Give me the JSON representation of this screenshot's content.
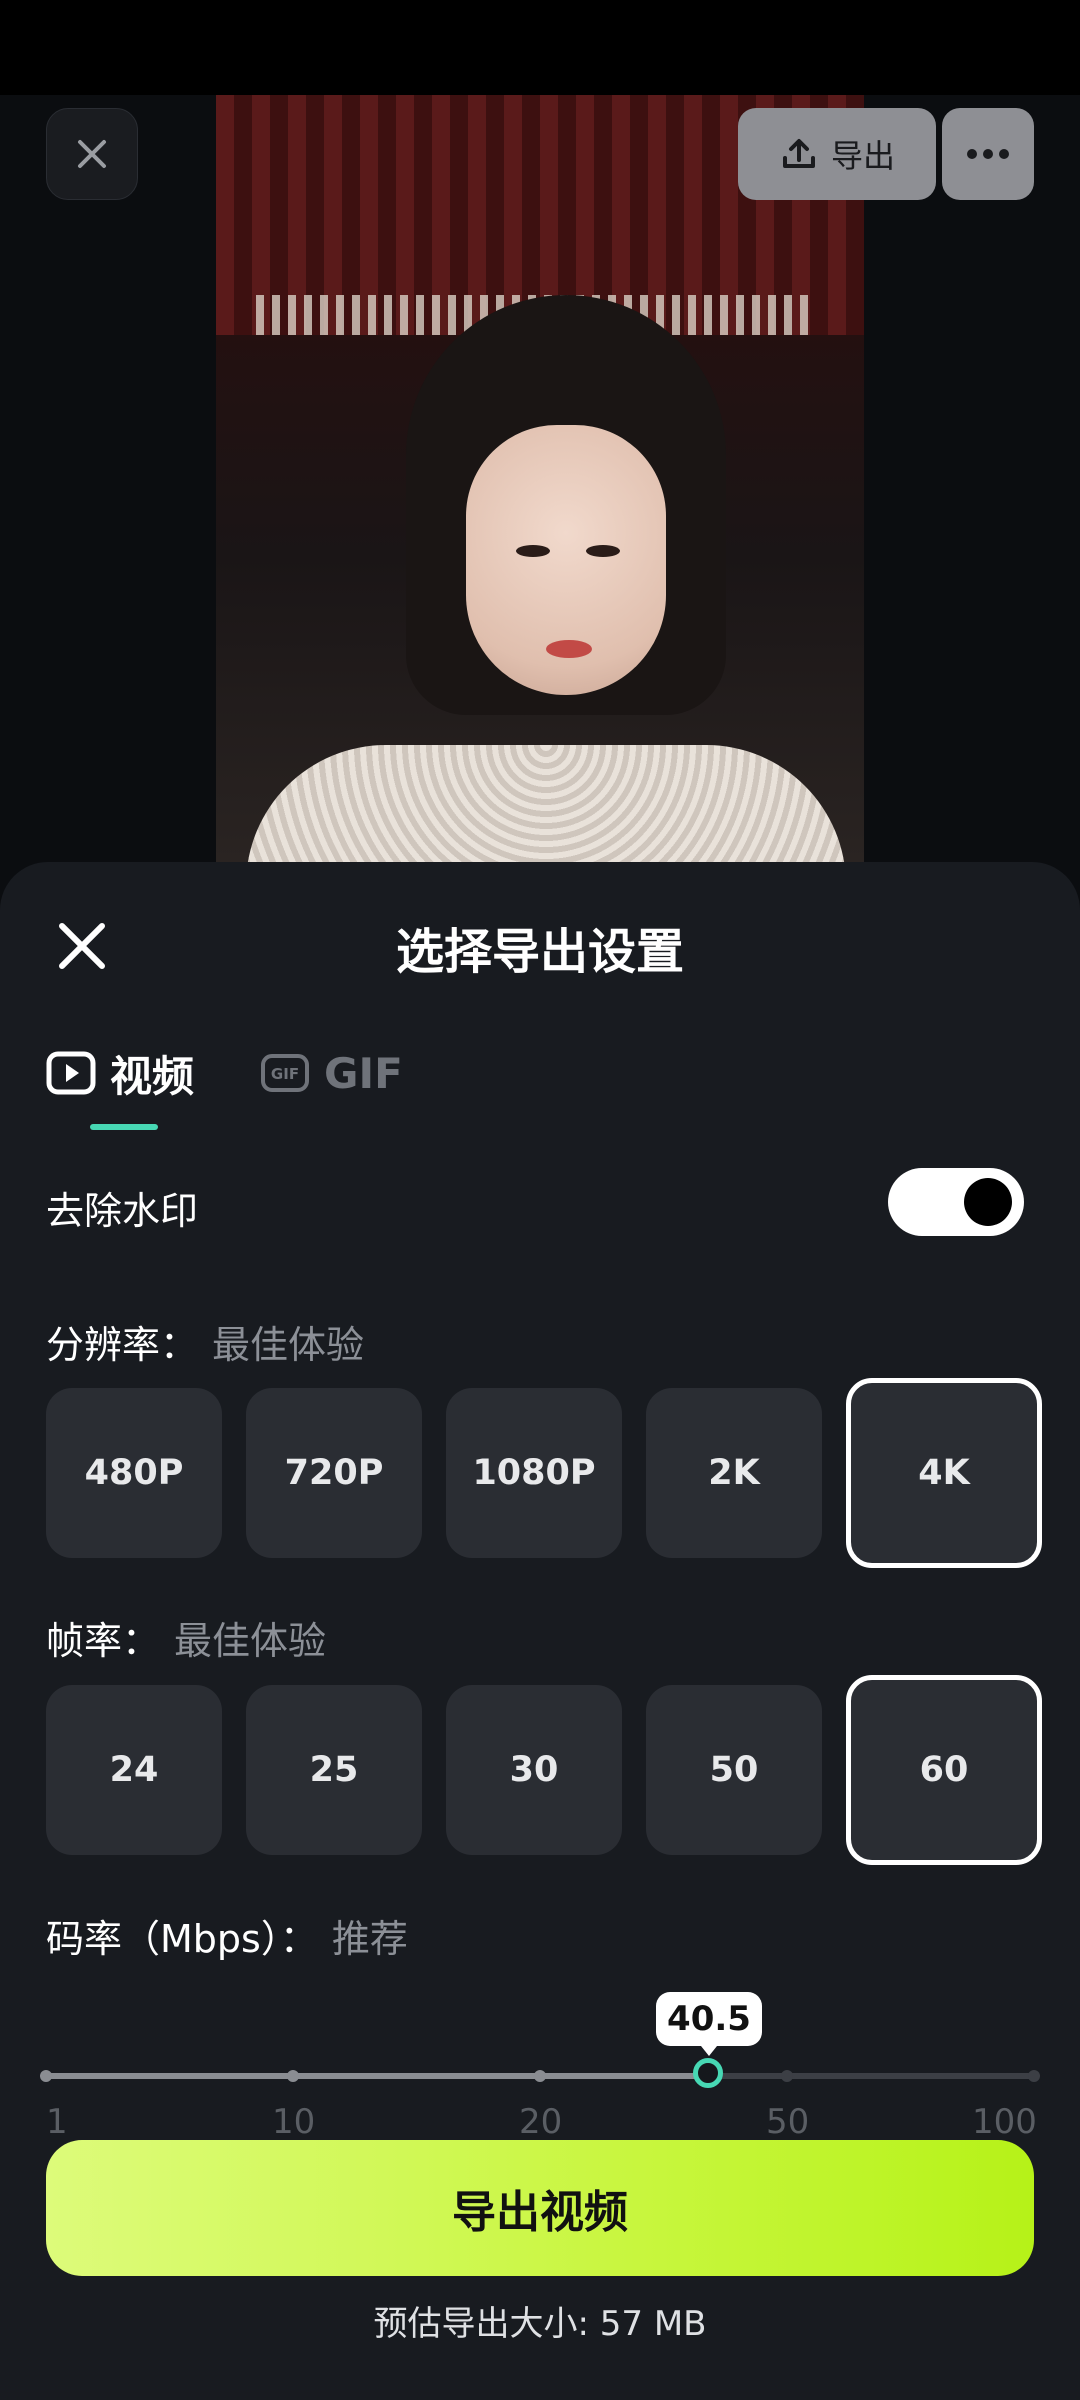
{
  "top_bar": {
    "export_label": "导出"
  },
  "sheet": {
    "title": "选择导出设置",
    "tabs": [
      {
        "label": "视频",
        "active": true
      },
      {
        "label": "GIF",
        "active": false
      }
    ],
    "watermark": {
      "label": "去除水印",
      "enabled": true
    },
    "resolution": {
      "label": "分辨率：",
      "hint": "最佳体验",
      "options": [
        "480P",
        "720P",
        "1080P",
        "2K",
        "4K"
      ],
      "selected": "4K"
    },
    "frame_rate": {
      "label": "帧率：",
      "hint": "最佳体验",
      "options": [
        "24",
        "25",
        "30",
        "50",
        "60"
      ],
      "selected": "60"
    },
    "bitrate": {
      "label": "码率（Mbps）：",
      "hint": "推荐",
      "value": "40.5",
      "ticks": [
        "1",
        "10",
        "20",
        "50",
        "100"
      ]
    },
    "export_button": "导出视频",
    "size_estimate": "预估导出大小: 57 MB"
  },
  "colors": {
    "accent": "#47d8b4",
    "export_button": "#c8f63e",
    "sheet_bg": "#181b20"
  }
}
